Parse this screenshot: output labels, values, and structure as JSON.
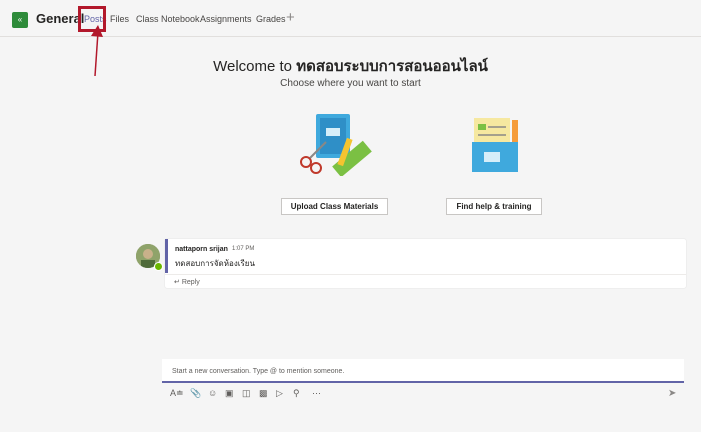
{
  "header": {
    "team_badge": "«",
    "channel": "General",
    "tabs": [
      {
        "label": "Posts",
        "active": true
      },
      {
        "label": "Files"
      },
      {
        "label": "Class Notebook"
      },
      {
        "label": "Assignments"
      },
      {
        "label": "Grades"
      }
    ],
    "add_tab_icon": "+"
  },
  "welcome": {
    "prefix": "Welcome to ",
    "team_name": "ทดสอบระบบการสอนออนไลน์",
    "subtitle": "Choose where you want to start",
    "cards": [
      {
        "label": "Upload Class Materials",
        "icon": "notebook-scissors-illustration"
      },
      {
        "label": "Find help & training",
        "icon": "folder-documents-illustration"
      }
    ]
  },
  "post": {
    "author": "nattaporn srijan",
    "time": "1:07 PM",
    "body": "ทดสอบการจัดห้องเรียน",
    "reply_label": "Reply"
  },
  "composer": {
    "placeholder": "Start a new conversation. Type @ to mention someone."
  },
  "colors": {
    "accent": "#6264a7",
    "team_badge": "#2e8b3a",
    "highlight": "#b2182b"
  }
}
